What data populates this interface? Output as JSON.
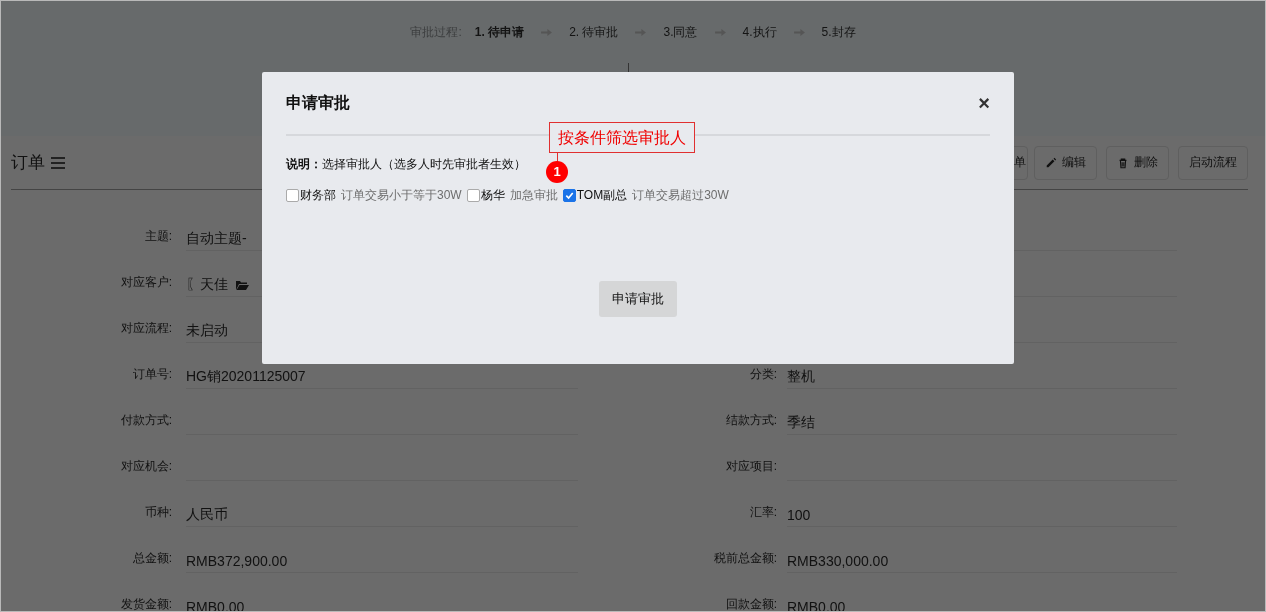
{
  "process": {
    "label": "审批过程:",
    "steps": [
      {
        "label": "1. 待申请",
        "selected": true
      },
      {
        "label": "2. 待审批",
        "selected": false
      },
      {
        "label": "3.同意",
        "selected": false
      },
      {
        "label": "4.执行",
        "selected": false
      },
      {
        "label": "5.封存",
        "selected": false
      }
    ]
  },
  "page": {
    "title": "订单",
    "toolbar": [
      {
        "label": "单"
      },
      {
        "label": "编辑"
      },
      {
        "label": "删除"
      },
      {
        "label": "启动流程"
      }
    ]
  },
  "rows": [
    {
      "left": {
        "label": "主题:",
        "value": "自动主题-"
      }
    },
    {
      "left": {
        "label": "对应客户:",
        "value": "〖天佳"
      }
    },
    {
      "left": {
        "label": "对应流程:",
        "value": "未启动"
      }
    },
    {
      "left": {
        "label": "订单号:",
        "value": "HG销20201125007"
      },
      "right": {
        "label": "分类:",
        "value": "整机"
      }
    },
    {
      "left": {
        "label": "付款方式:"
      },
      "right": {
        "label": "结款方式:",
        "value": "季结"
      }
    },
    {
      "left": {
        "label": "对应机会:"
      },
      "right": {
        "label": "对应项目:"
      }
    },
    {
      "left": {
        "label": "币种:",
        "value": "人民币"
      },
      "right": {
        "label": "汇率:",
        "value": "100"
      }
    },
    {
      "left": {
        "label": "总金额:",
        "value": "RMB372,900.00"
      },
      "right": {
        "label": "税前总金额:",
        "value": "RMB330,000.00"
      }
    },
    {
      "left": {
        "label": "发货金额:",
        "value": "RMB0.00"
      },
      "right": {
        "label": "回款金额:",
        "value": "RMB0.00"
      }
    }
  ],
  "dialog": {
    "title": "申请审批",
    "close": "×",
    "description": "**说明：**选择审批人（选多人时先审批者生效）",
    "approvers": [
      {
        "name": "财务部",
        "condition": "订单交易小于等于30W",
        "checked": false
      },
      {
        "name": "杨华",
        "condition": "加急审批",
        "checked": false
      },
      {
        "name": "TOM副总",
        "condition": "订单交易超过30W",
        "checked": true
      }
    ],
    "submit": "申请审批"
  },
  "annotation": {
    "number": "1",
    "text": "按条件筛选审批人"
  }
}
